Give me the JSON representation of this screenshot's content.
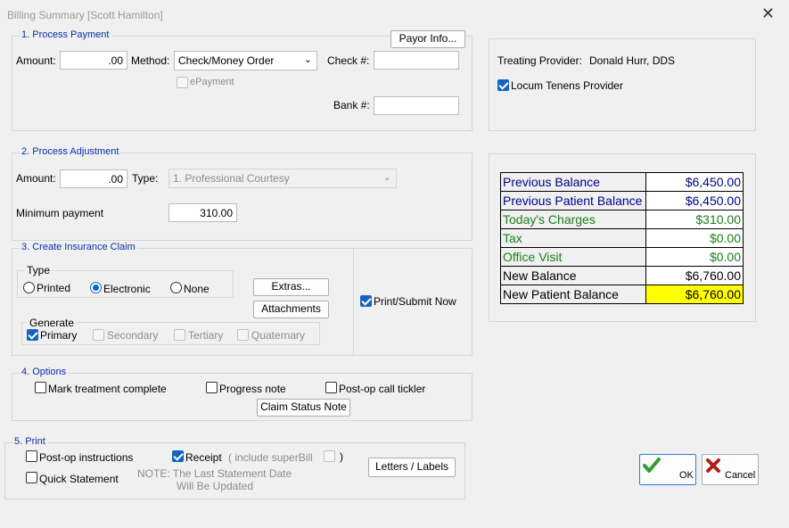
{
  "window": {
    "title": "Billing Summary [Scott Hamilton]",
    "close": "✕"
  },
  "payment": {
    "title": "1. Process Payment",
    "payor_button": "Payor Info...",
    "amount_label": "Amount:",
    "amount_value": ".00",
    "method_label": "Method:",
    "method_value": "Check/Money Order",
    "check_label": "Check #:",
    "check_value": "",
    "epayment_label": "ePayment",
    "bank_label": "Bank #:",
    "bank_value": ""
  },
  "adjustment": {
    "title": "2. Process Adjustment",
    "amount_label": "Amount:",
    "amount_value": ".00",
    "type_label": "Type:",
    "type_value": "1. Professional Courtesy",
    "min_label": "Minimum payment",
    "min_value": "310.00"
  },
  "claim": {
    "title": "3. Create Insurance Claim",
    "type_label": "Type",
    "type_printed": "Printed",
    "type_electronic": "Electronic",
    "type_none": "None",
    "extras_button": "Extras...",
    "attachments_button": "Attachments",
    "generate_label": "Generate",
    "primary": "Primary",
    "secondary": "Secondary",
    "tertiary": "Tertiary",
    "quaternary": "Quaternary",
    "print_submit": "Print/Submit Now"
  },
  "options": {
    "title": "4. Options",
    "mark_complete": "Mark treatment complete",
    "progress_note": "Progress note",
    "postop_tickler": "Post-op call tickler",
    "claim_status_button": "Claim Status Note"
  },
  "print": {
    "title": "5. Print",
    "postop_instructions": "Post-op instructions",
    "receipt": "Receipt",
    "include_superbill": "( include superBill",
    "close_paren": ")",
    "quick_statement": "Quick Statement",
    "note_line1": "NOTE: The Last Statement Date",
    "note_line2": "Will Be Updated",
    "letters_button": "Letters / Labels"
  },
  "provider": {
    "treating_label": "Treating Provider:",
    "treating_name": "Donald Hurr, DDS",
    "locum": "Locum Tenens Provider"
  },
  "summary": [
    {
      "label": "Previous Balance",
      "value": "$6,450.00",
      "color": "#00008b",
      "bg": "#ffffff"
    },
    {
      "label": "Previous Patient Balance",
      "value": "$6,450.00",
      "color": "#00008b",
      "bg": "#ffffff"
    },
    {
      "label": "Today's Charges",
      "value": "$310.00",
      "color": "#1a7f1a",
      "bg": "#ffffff"
    },
    {
      "label": "Tax",
      "value": "$0.00",
      "color": "#1a7f1a",
      "bg": "#ffffff"
    },
    {
      "label": "Office Visit",
      "value": "$0.00",
      "color": "#1a7f1a",
      "bg": "#ffffff"
    },
    {
      "label": "New Balance",
      "value": "$6,760.00",
      "color": "#000000",
      "bg": "#ffffff"
    },
    {
      "label": "New Patient Balance",
      "value": "$6,760.00",
      "color": "#000000",
      "bg": "#ffff00"
    }
  ],
  "buttons": {
    "ok": "OK",
    "cancel": "Cancel"
  }
}
